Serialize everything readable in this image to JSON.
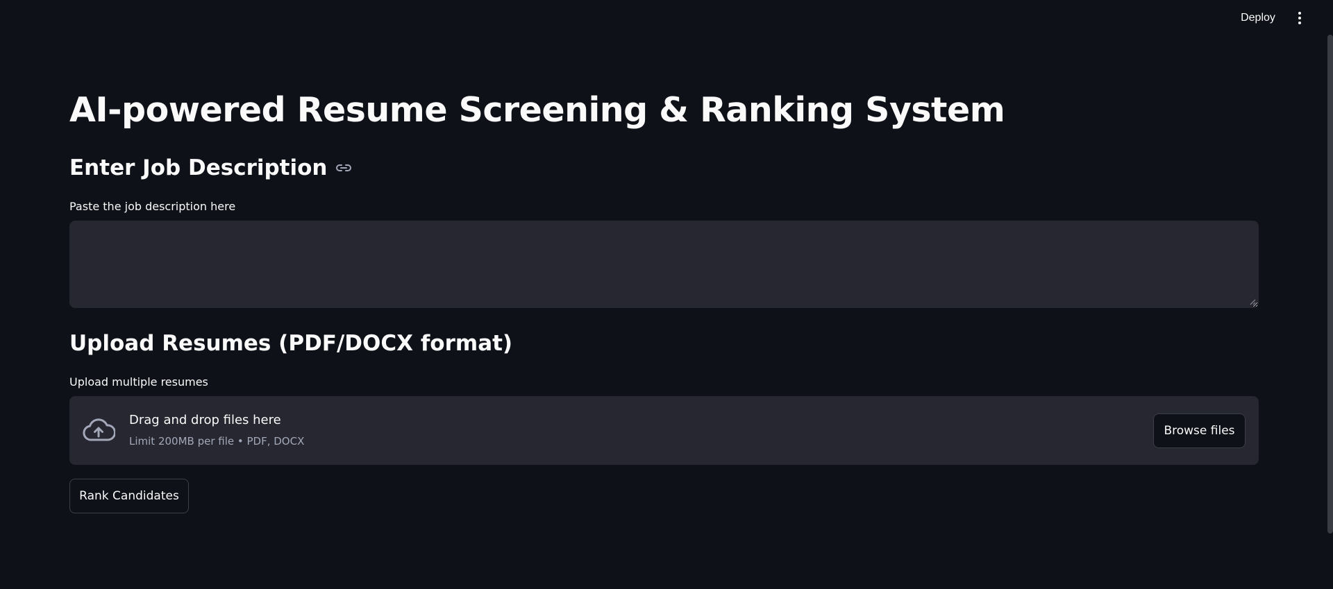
{
  "header": {
    "deploy_label": "Deploy",
    "menu_icon": "more-vertical-icon"
  },
  "main": {
    "title": "AI-powered Resume Screening & Ranking System",
    "job_section": {
      "heading": "Enter Job Description",
      "anchor_icon": "link-icon",
      "textarea_label": "Paste the job description here",
      "textarea_value": ""
    },
    "upload_section": {
      "heading": "Upload Resumes (PDF/DOCX format)",
      "uploader_label": "Upload multiple resumes",
      "upload_icon": "cloud-upload-icon",
      "dropzone_title": "Drag and drop files here",
      "dropzone_subtitle": "Limit 200MB per file • PDF, DOCX",
      "browse_label": "Browse files"
    },
    "rank_button_label": "Rank Candidates"
  },
  "colors": {
    "background": "#0e1117",
    "surface": "#262730",
    "text": "#fafafa",
    "muted_text": "#a3a8b8",
    "border": "#3d3f48"
  }
}
